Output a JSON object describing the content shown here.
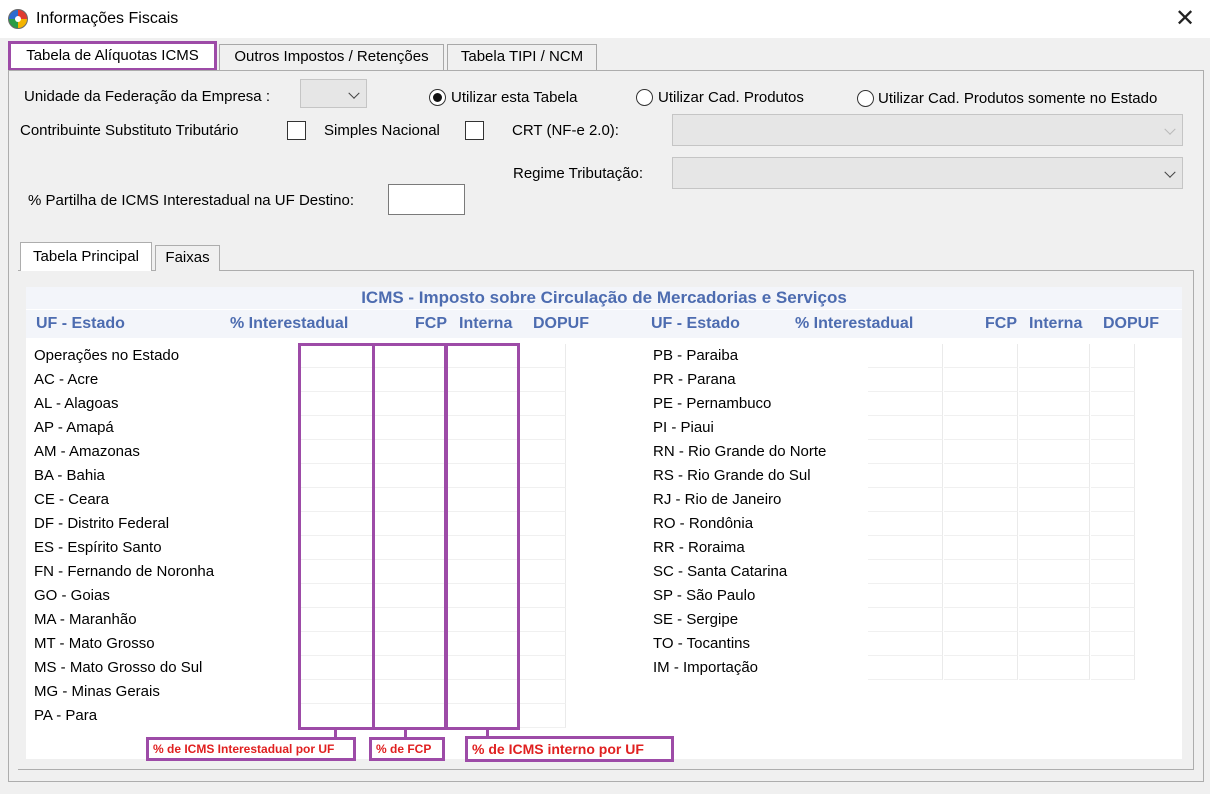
{
  "window": {
    "title": "Informações Fiscais"
  },
  "tabs": [
    {
      "label": "Tabela de Alíquotas ICMS"
    },
    {
      "label": "Outros Impostos / Retenções"
    },
    {
      "label": "Tabela TIPI / NCM"
    }
  ],
  "form": {
    "uf_empresa_label": "Unidade da Federação da Empresa :",
    "uf_empresa_value": "",
    "radio_tabela": "Utilizar esta Tabela",
    "radio_cad": "Utilizar Cad. Produtos",
    "radio_cad_estado": "Utilizar Cad. Produtos somente no Estado",
    "contrib_label": "Contribuinte Substituto Tributário",
    "simples_label": "Simples Nacional",
    "crt_label": "CRT (NF-e 2.0):",
    "crt_value": "",
    "regime_label": "Regime Tributação:",
    "regime_value": "",
    "partilha_label": "% Partilha de ICMS Interestadual na UF Destino:",
    "partilha_value": ""
  },
  "inner_tabs": [
    {
      "label": "Tabela Principal"
    },
    {
      "label": "Faixas"
    }
  ],
  "grid": {
    "title": "ICMS - Imposto sobre Circulação de Mercadorias e Serviços",
    "headers": {
      "uf": "UF - Estado",
      "interestadual": "% Interestadual",
      "fcp": "FCP",
      "interna": "Interna",
      "dopuf": "DOPUF"
    },
    "left_states": [
      "Operações no Estado",
      "AC - Acre",
      "AL - Alagoas",
      "AP - Amapá",
      "AM - Amazonas",
      "BA - Bahia",
      "CE - Ceara",
      "DF - Distrito Federal",
      "ES - Espírito Santo",
      "FN - Fernando de Noronha",
      "GO - Goias",
      "MA - Maranhão",
      "MT - Mato Grosso",
      "MS - Mato Grosso do Sul",
      "MG - Minas Gerais",
      "PA - Para"
    ],
    "right_states": [
      "PB - Paraiba",
      "PR - Parana",
      "PE - Pernambuco",
      "PI - Piaui",
      "RN - Rio Grande do Norte",
      "RS - Rio Grande do Sul",
      "RJ - Rio de Janeiro",
      "RO - Rondônia",
      "RR - Roraima",
      "SC - Santa Catarina",
      "SP - São Paulo",
      "SE - Sergipe",
      "TO - Tocantins",
      "IM - Importação"
    ]
  },
  "annotations": {
    "interestadual": "% de ICMS Interestadual por UF",
    "fcp": "% de FCP",
    "interno": "% de ICMS interno por UF"
  },
  "colors": {
    "highlight": "#9d4ba7",
    "annotation_text": "#e02020",
    "header_text": "#4d6cb0"
  }
}
